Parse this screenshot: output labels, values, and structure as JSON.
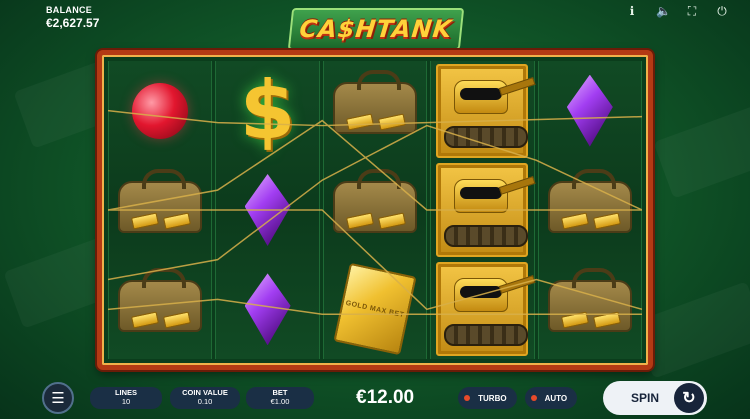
{
  "balance": {
    "label": "BALANCE",
    "value": "€2,627.57"
  },
  "top_icons": [
    {
      "name": "info-icon",
      "glyph": "ℹ"
    },
    {
      "name": "sound-icon",
      "glyph": "🔈"
    },
    {
      "name": "fullscreen-icon",
      "glyph": "⛶"
    },
    {
      "name": "power-icon",
      "glyph": "⏻"
    }
  ],
  "logo": {
    "text": "CA$HTANK"
  },
  "reels": [
    [
      "ruby",
      "gold-bag",
      "gold-bag"
    ],
    [
      "dollar-sign",
      "amethyst",
      "amethyst"
    ],
    [
      "gold-bag",
      "gold-bag",
      "gold-bar"
    ],
    [
      "tank",
      "tank",
      "tank"
    ],
    [
      "amethyst",
      "gold-bag",
      "gold-bag"
    ]
  ],
  "gold_bar_text": "GOLD MAX BET",
  "colors": {
    "frame": "#b33a14",
    "payline": "#d8b04a",
    "spin_bg": "#eef2f6",
    "panel": "#1a2f45"
  },
  "controls": {
    "menu_icon": "☰",
    "lines": {
      "label": "LINES",
      "value": "10"
    },
    "coin_value": {
      "label": "COIN VALUE",
      "value": "0.10"
    },
    "bet": {
      "label": "BET",
      "value": "€1.00"
    },
    "total_bet": "€12.00",
    "turbo": "TURBO",
    "auto": "AUTO",
    "spin": "SPIN",
    "spin_icon": "↻"
  }
}
